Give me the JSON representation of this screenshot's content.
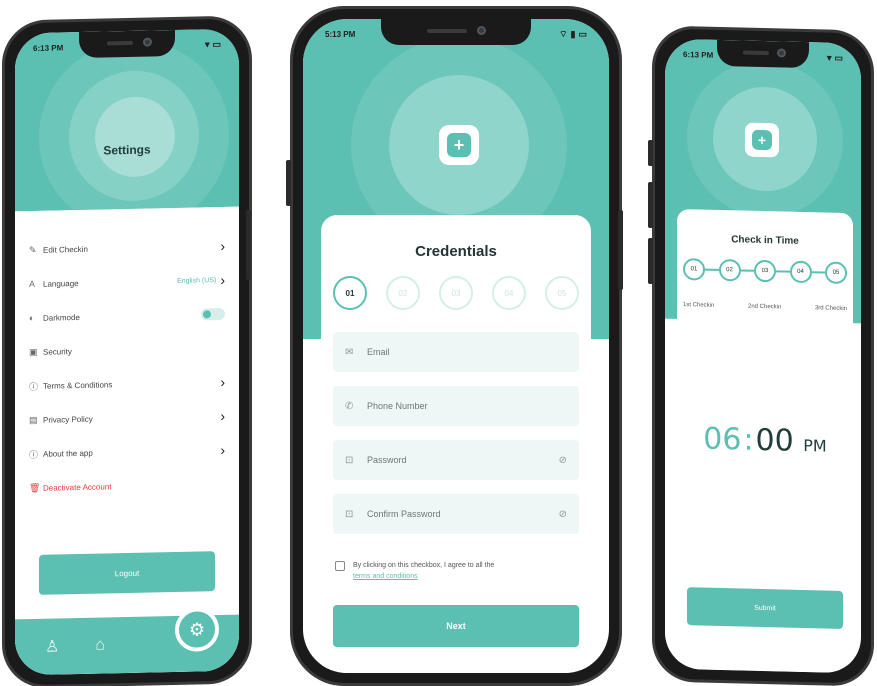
{
  "colors": {
    "accent": "#5bbfb1",
    "danger": "#e63b3b",
    "field_bg": "#eef7f6"
  },
  "settings_screen": {
    "status_time": "6:13 PM",
    "title": "Settings",
    "items": [
      {
        "icon": "edit-icon",
        "label": "Edit Checkin",
        "control": "chevron"
      },
      {
        "icon": "language-icon",
        "label": "Language",
        "value": "English (US)",
        "control": "chevron"
      },
      {
        "icon": "darkmode-icon",
        "label": "Darkmode",
        "control": "toggle"
      },
      {
        "icon": "lock-icon",
        "label": "Security",
        "control": "none"
      },
      {
        "icon": "info-icon",
        "label": "Terms & Conditions",
        "control": "chevron"
      },
      {
        "icon": "document-icon",
        "label": "Privacy Policy",
        "control": "chevron"
      },
      {
        "icon": "info-icon",
        "label": "About the app",
        "control": "chevron"
      },
      {
        "icon": "trash-icon",
        "label": "Deactivate Account",
        "control": "none"
      }
    ],
    "logout_label": "Logout",
    "tabbar": {
      "icons": [
        "profile-icon",
        "home-icon",
        "settings-icon"
      ]
    }
  },
  "credentials_screen": {
    "status_time": "5:13 PM",
    "title": "Credentials",
    "steps": [
      "01",
      "02",
      "03",
      "04",
      "05"
    ],
    "active_step": "01",
    "fields": [
      {
        "icon": "email-icon",
        "placeholder": "Email",
        "has_eye": false
      },
      {
        "icon": "phone-icon",
        "placeholder": "Phone Number",
        "has_eye": false
      },
      {
        "icon": "lock-icon",
        "placeholder": "Password",
        "has_eye": true
      },
      {
        "icon": "lock-icon",
        "placeholder": "Confirm Password",
        "has_eye": true
      }
    ],
    "agreement_text": "By clicking on this checkbox, I agree to all the",
    "agreement_link": "terms and conditions",
    "next_label": "Next"
  },
  "checkin_screen": {
    "status_time": "6:13 PM",
    "title": "Check in Time",
    "steps": [
      "01",
      "02",
      "03",
      "04",
      "05"
    ],
    "options": [
      "1st Checkin",
      "2nd Checkin",
      "3rd Checkin"
    ],
    "time": {
      "hour": "06",
      "minute": "00",
      "period": "PM"
    },
    "submit_label": "Submit"
  }
}
